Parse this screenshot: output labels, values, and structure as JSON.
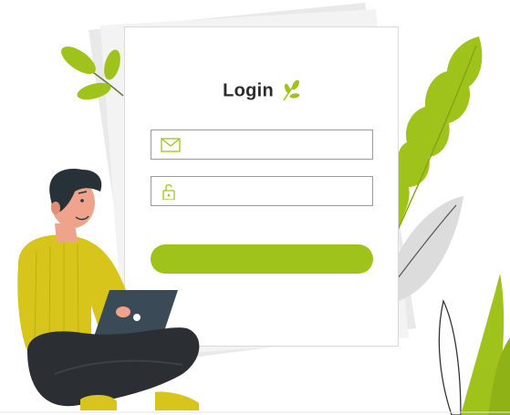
{
  "login": {
    "title": "Login",
    "email_value": "",
    "password_value": "",
    "submit_label": ""
  },
  "colors": {
    "accent": "#a0c31b",
    "card_border": "#d9d9d9",
    "field_border": "#9a9a9a",
    "sweater": "#d8c51c",
    "pants": "#2b2f33",
    "laptop": "#3a4a56"
  },
  "icons": {
    "title_icon": "sprout-icon",
    "email_icon": "envelope-icon",
    "password_icon": "padlock-icon"
  }
}
